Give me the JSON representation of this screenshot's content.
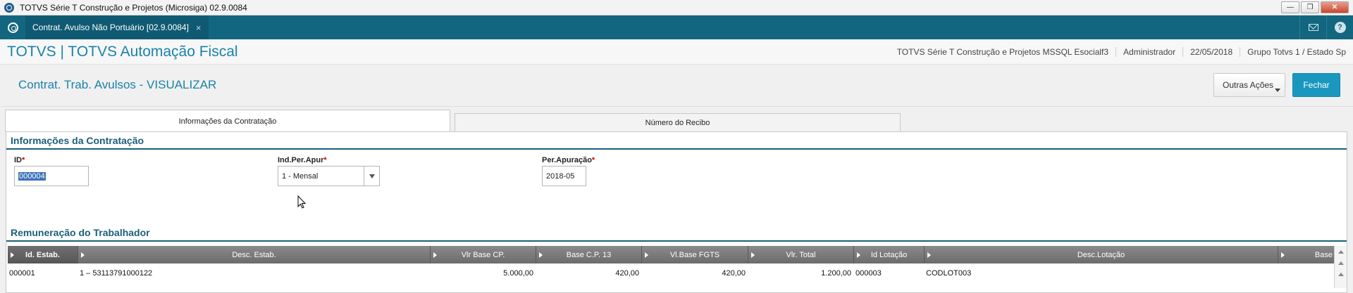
{
  "window": {
    "title": "TOTVS Série T Construção e Projetos (Microsiga) 02.9.0084"
  },
  "tabstrip": {
    "doc_tab_label": "Contrat. Avulso Não Portuário [02.9.0084]",
    "doc_tab_close": "×"
  },
  "header": {
    "brand": "TOTVS | TOTVS Automação Fiscal",
    "environment": "TOTVS Série T Construção e Projetos MSSQL Esocialf3",
    "user": "Administrador",
    "date": "22/05/2018",
    "company": "Grupo Totvs 1 / Estado Sp"
  },
  "page": {
    "title": "Contrat. Trab. Avulsos - VISUALIZAR",
    "other_actions_label": "Outras Ações",
    "close_label": "Fechar"
  },
  "folder_tabs": [
    {
      "label": "Informações da Contratação",
      "active": true
    },
    {
      "label": "Número do Recibo",
      "active": false
    }
  ],
  "contratacao": {
    "section_title": "Informações da Contratação",
    "id_label": "ID",
    "id_value": "000004",
    "ind_per_apur_label": "Ind.Per.Apur",
    "ind_per_apur_value": "1 - Mensal",
    "per_apuracao_label": "Per.Apuração",
    "per_apuracao_value": "2018-05",
    "required_mark": "*"
  },
  "remuneracao": {
    "section_title": "Remuneração do Trabalhador",
    "columns": [
      "Id. Estab.",
      "Desc. Estab.",
      "Vlr Base CP.",
      "Base C.P. 13",
      "Vl.Base FGTS",
      "Vlr. Total",
      "Id Lotação",
      "Desc.Lotação",
      "Base"
    ],
    "rows": [
      [
        "000001",
        "1 – 53113791000122",
        "5.000,00",
        "420,00",
        "420,00",
        "1.200,00",
        "000003",
        "CODLOT003",
        ""
      ]
    ]
  },
  "colors": {
    "accent": "#1a83a8",
    "tabstrip": "#13667f",
    "section": "#1a5f7a",
    "primary_button": "#1a97bf",
    "required": "#d20000"
  }
}
